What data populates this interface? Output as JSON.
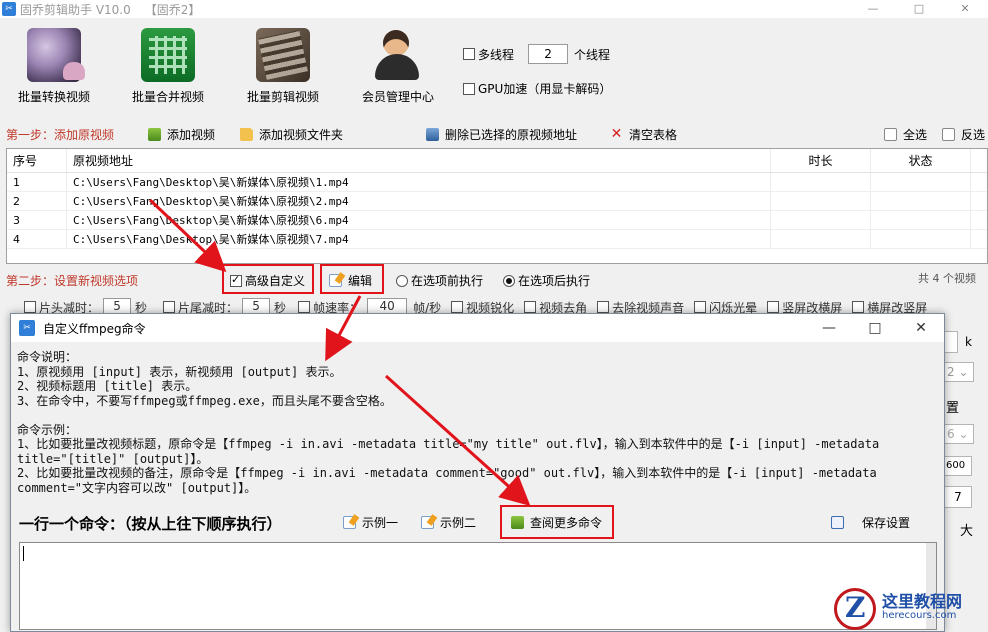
{
  "window": {
    "title": "固乔剪辑助手 V10.0",
    "subtitle": "【固乔2】",
    "icon": "app-icon",
    "controls": [
      "—",
      "□",
      "✕"
    ]
  },
  "toolbar": [
    {
      "label": "批量转换视频",
      "icon": "film-reel-icon"
    },
    {
      "label": "批量合并视频",
      "icon": "merge-grid-icon"
    },
    {
      "label": "批量剪辑视频",
      "icon": "film-edit-icon"
    },
    {
      "label": "会员管理中心",
      "icon": "member-icon"
    }
  ],
  "options": {
    "multithread_label": "多线程",
    "thread_count": "2",
    "thread_unit": "个线程",
    "gpu_label": "GPU加速（用显卡解码）"
  },
  "step1": {
    "label": "第一步：添加原视频",
    "add_video": "添加视频",
    "add_folder": "添加视频文件夹",
    "delete_selected": "删除已选择的原视频地址",
    "clear_table": "清空表格",
    "select_all": "全选",
    "invert": "反选"
  },
  "table": {
    "headers": [
      "序号",
      "原视频地址",
      "时长",
      "状态"
    ],
    "rows": [
      {
        "no": "1",
        "path": "C:\\Users\\Fang\\Desktop\\吴\\新媒体\\原视频\\1.mp4",
        "duration": "",
        "status": ""
      },
      {
        "no": "2",
        "path": "C:\\Users\\Fang\\Desktop\\吴\\新媒体\\原视频\\2.mp4",
        "duration": "",
        "status": ""
      },
      {
        "no": "3",
        "path": "C:\\Users\\Fang\\Desktop\\吴\\新媒体\\原视频\\6.mp4",
        "duration": "",
        "status": ""
      },
      {
        "no": "4",
        "path": "C:\\Users\\Fang\\Desktop\\吴\\新媒体\\原视频\\7.mp4",
        "duration": "",
        "status": ""
      }
    ]
  },
  "step2": {
    "label": "第二步：设置新视频选项",
    "advanced_custom": "高级自定义",
    "edit": "编辑",
    "before_exec": "在选项前执行",
    "after_exec": "在选项后执行",
    "count": "共 4 个视频"
  },
  "bg_options": {
    "head_cut": "片头减时：",
    "head_val": "5",
    "sec": "秒",
    "tail_cut": "片尾减时：",
    "tail_val": "5",
    "sec2": "秒",
    "fps": "帧速率：",
    "fps_val": "40",
    "fps_unit": "帧/秒",
    "sharpen": "视频锐化",
    "mirror": "视频去角",
    "remove_audio": "去除视频声音",
    "flash": "闪烁光晕",
    "vertical": "竖屏改横屏",
    "horizontal": "横屏改竖屏"
  },
  "right_peek": {
    "k": "k",
    "v1": "2",
    "place": "置",
    "v2": "6",
    "v3": "600",
    "v4": "7",
    "big": "大"
  },
  "dialog": {
    "title": "自定义ffmpeg命令",
    "description": "命令说明：\n1、原视频用 [input] 表示，新视频用 [output] 表示。\n2、视频标题用 [title] 表示。\n3、在命令中，不要写ffmpeg或ffmpeg.exe，而且头尾不要含空格。\n\n命令示例：\n1、比如要批量改视频标题，原命令是【ffmpeg -i in.avi -metadata title=\"my title\" out.flv】，输入到本软件中的是【-i [input] -metadata\ntitle=\"[title]\" [output]】。\n2、比如要批量改视频的备注，原命令是【ffmpeg -i in.avi -metadata comment=\"good\" out.flv】，输入到本软件中的是【-i [input] -metadata\ncomment=\"文字内容可以改\" [output]】。",
    "command_label": "一行一个命令：（按从上往下顺序执行）",
    "example1": "示例一",
    "example2": "示例二",
    "more_commands": "查阅更多命令",
    "save": "保存设置",
    "command_text": ""
  },
  "watermark": {
    "name": "这里教程网",
    "url": "herecours.com"
  },
  "colors": {
    "step_label": "#c0392b",
    "annotation_red": "#e0141a",
    "app_blue": "#2f7fd8"
  }
}
